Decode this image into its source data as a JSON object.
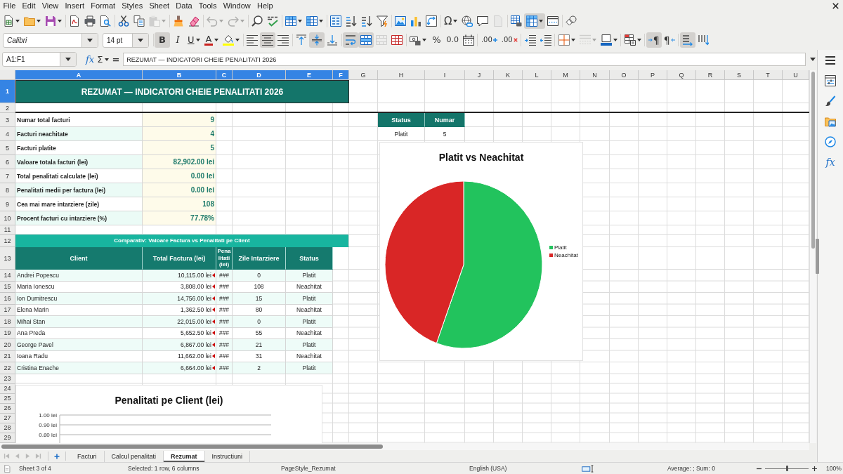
{
  "menu_bar": [
    "File",
    "Edit",
    "View",
    "Insert",
    "Format",
    "Styles",
    "Sheet",
    "Data",
    "Tools",
    "Window",
    "Help"
  ],
  "standard_toolbar": [
    [
      {
        "kind": "new",
        "pressed": false,
        "disabled": false
      },
      {
        "kind": "open",
        "pressed": false,
        "disabled": false
      },
      {
        "kind": "save",
        "pressed": false,
        "disabled": false
      }
    ],
    [
      {
        "kind": "pdf",
        "pressed": false,
        "disabled": false
      },
      {
        "kind": "print",
        "pressed": false,
        "disabled": false
      },
      {
        "kind": "preview",
        "pressed": false,
        "disabled": false
      }
    ],
    [
      {
        "kind": "cut",
        "pressed": false,
        "disabled": false
      },
      {
        "kind": "copy",
        "pressed": false,
        "disabled": false
      },
      {
        "kind": "paste",
        "pressed": false,
        "disabled": true
      }
    ],
    [
      {
        "kind": "clone",
        "pressed": false,
        "disabled": false
      },
      {
        "kind": "clear",
        "pressed": false,
        "disabled": false
      }
    ],
    [
      {
        "kind": "undo",
        "pressed": false,
        "disabled": true
      },
      {
        "kind": "redo",
        "pressed": false,
        "disabled": true
      }
    ],
    [
      {
        "kind": "find",
        "pressed": false,
        "disabled": false
      },
      {
        "kind": "spelling",
        "pressed": false,
        "disabled": false
      }
    ],
    [
      {
        "kind": "rows",
        "pressed": false,
        "disabled": false
      },
      {
        "kind": "columns",
        "pressed": false,
        "disabled": false
      }
    ],
    [
      {
        "kind": "sort",
        "pressed": false,
        "disabled": false
      },
      {
        "kind": "ascending",
        "pressed": false,
        "disabled": false
      },
      {
        "kind": "descending",
        "pressed": false,
        "disabled": false
      },
      {
        "kind": "autofilter",
        "pressed": false,
        "disabled": false
      }
    ],
    [
      {
        "kind": "image",
        "pressed": false,
        "disabled": false
      },
      {
        "kind": "chart",
        "pressed": false,
        "disabled": false
      },
      {
        "kind": "pivot",
        "pressed": false,
        "disabled": false
      }
    ],
    [
      {
        "kind": "symbol",
        "label": "Ω",
        "pressed": false,
        "disabled": false
      },
      {
        "kind": "hyperlink",
        "pressed": false,
        "disabled": false
      },
      {
        "kind": "comment",
        "pressed": false,
        "disabled": false
      },
      {
        "kind": "headers",
        "pressed": false,
        "disabled": true
      }
    ],
    [
      {
        "kind": "printarea",
        "pressed": false,
        "disabled": false
      },
      {
        "kind": "freeze",
        "pressed": true,
        "disabled": false
      },
      {
        "kind": "split",
        "pressed": false,
        "disabled": false
      }
    ],
    [
      {
        "kind": "shapes",
        "pressed": false,
        "disabled": false
      }
    ]
  ],
  "formatting_toolbar": {
    "font_name": "Calibri",
    "font_size": "14 pt",
    "groups": [
      [
        {
          "kind": "bold",
          "label": "B",
          "pressed": true,
          "disabled": false
        },
        {
          "kind": "italic",
          "label": "I",
          "pressed": false,
          "disabled": false
        },
        {
          "kind": "underline",
          "label": "U",
          "pressed": false,
          "disabled": false
        },
        {
          "kind": "fontcolor",
          "label": "A",
          "pressed": false,
          "disabled": false
        },
        {
          "kind": "highlight",
          "pressed": false,
          "disabled": false
        }
      ],
      [
        {
          "kind": "left",
          "pressed": false,
          "disabled": false
        },
        {
          "kind": "center",
          "pressed": true,
          "disabled": false
        },
        {
          "kind": "right",
          "pressed": false,
          "disabled": false
        }
      ],
      [
        {
          "kind": "top",
          "pressed": false,
          "disabled": false
        },
        {
          "kind": "middle",
          "pressed": true,
          "disabled": false
        },
        {
          "kind": "bottom",
          "pressed": false,
          "disabled": false
        }
      ],
      [
        {
          "kind": "wrap",
          "pressed": true,
          "disabled": false
        },
        {
          "kind": "mergecenter",
          "pressed": true,
          "disabled": false
        },
        {
          "kind": "merge",
          "pressed": false,
          "disabled": true
        },
        {
          "kind": "unmerge",
          "pressed": false,
          "disabled": false
        }
      ],
      [
        {
          "kind": "currency",
          "pressed": false,
          "disabled": false
        },
        {
          "kind": "percent",
          "label": "%",
          "pressed": false,
          "disabled": false
        },
        {
          "kind": "number",
          "label": "0.0",
          "pressed": false,
          "disabled": false
        },
        {
          "kind": "date",
          "pressed": false,
          "disabled": false
        }
      ],
      [
        {
          "kind": "adddecimal",
          "label": ".00",
          "pressed": false,
          "disabled": false
        },
        {
          "kind": "deldecimal",
          "label": ".00",
          "pressed": false,
          "disabled": false
        }
      ],
      [
        {
          "kind": "indent",
          "pressed": false,
          "disabled": false
        },
        {
          "kind": "outdent",
          "pressed": false,
          "disabled": false
        }
      ],
      [
        {
          "kind": "borders",
          "pressed": false,
          "disabled": false
        },
        {
          "kind": "borderstyle",
          "pressed": false,
          "disabled": true
        },
        {
          "kind": "bordercolor",
          "pressed": false,
          "disabled": false
        }
      ],
      [
        {
          "kind": "conditional",
          "pressed": false,
          "disabled": false
        }
      ],
      [
        {
          "kind": "ltr",
          "label": "¶",
          "pressed": true,
          "disabled": false
        },
        {
          "kind": "rtl",
          "label": "¶",
          "pressed": false,
          "disabled": false
        }
      ],
      [
        {
          "kind": "horizontal",
          "pressed": true,
          "disabled": false
        },
        {
          "kind": "vertical",
          "pressed": false,
          "disabled": false
        }
      ]
    ]
  },
  "formula_bar": {
    "name_box": "A1:F1",
    "wizard": "fx",
    "sum": "Σ",
    "equals": "=",
    "value": "REZUMAT — INDICATORI CHEIE PENALITATI 2026"
  },
  "sheet": {
    "column_headers": [
      {
        "label": "A",
        "selected": true
      },
      {
        "label": "B",
        "selected": true
      },
      {
        "label": "C",
        "selected": true
      },
      {
        "label": "D",
        "selected": true
      },
      {
        "label": "E",
        "selected": true
      },
      {
        "label": "F",
        "selected": true
      },
      {
        "label": "G",
        "selected": false
      },
      {
        "label": "H",
        "selected": false
      },
      {
        "label": "I",
        "selected": false
      },
      {
        "label": "J",
        "selected": false
      },
      {
        "label": "K",
        "selected": false
      },
      {
        "label": "L",
        "selected": false
      },
      {
        "label": "M",
        "selected": false
      },
      {
        "label": "N",
        "selected": false
      },
      {
        "label": "O",
        "selected": false
      },
      {
        "label": "P",
        "selected": false
      },
      {
        "label": "Q",
        "selected": false
      },
      {
        "label": "R",
        "selected": false
      },
      {
        "label": "S",
        "selected": false
      },
      {
        "label": "T",
        "selected": false
      },
      {
        "label": "U",
        "selected": false
      }
    ],
    "row_headers": [
      {
        "label": "1",
        "selected": true
      },
      {
        "label": "2",
        "selected": false
      },
      {
        "label": "3",
        "selected": false
      },
      {
        "label": "4",
        "selected": false
      },
      {
        "label": "5",
        "selected": false
      },
      {
        "label": "6",
        "selected": false
      },
      {
        "label": "7",
        "selected": false
      },
      {
        "label": "8",
        "selected": false
      },
      {
        "label": "9",
        "selected": false
      },
      {
        "label": "10",
        "selected": false
      },
      {
        "label": "11",
        "selected": false
      },
      {
        "label": "12",
        "selected": false
      },
      {
        "label": "13",
        "selected": false
      },
      {
        "label": "14",
        "selected": false
      },
      {
        "label": "15",
        "selected": false
      },
      {
        "label": "16",
        "selected": false
      },
      {
        "label": "17",
        "selected": false
      },
      {
        "label": "18",
        "selected": false
      },
      {
        "label": "19",
        "selected": false
      },
      {
        "label": "20",
        "selected": false
      },
      {
        "label": "21",
        "selected": false
      },
      {
        "label": "22",
        "selected": false
      },
      {
        "label": "23",
        "selected": false
      },
      {
        "label": "24",
        "selected": false
      },
      {
        "label": "25",
        "selected": false
      },
      {
        "label": "26",
        "selected": false
      },
      {
        "label": "27",
        "selected": false
      },
      {
        "label": "28",
        "selected": false
      },
      {
        "label": "29",
        "selected": false
      }
    ],
    "title": {
      "text": "REZUMAT — INDICATORI CHEIE PENALITATI 2026",
      "selected": true
    },
    "indicators": [
      {
        "label": "Numar total facturi",
        "value": "9"
      },
      {
        "label": "Facturi neachitate",
        "value": "4"
      },
      {
        "label": "Facturi platite",
        "value": "5"
      },
      {
        "label": "Valoare totala facturi (lei)",
        "value": "82,902.00 lei"
      },
      {
        "label": "Total penalitati calculate (lei)",
        "value": "0.00 lei"
      },
      {
        "label": "Penalitati medii per factura (lei)",
        "value": "0.00 lei"
      },
      {
        "label": "Cea mai mare intarziere (zile)",
        "value": "108"
      },
      {
        "label": "Procent facturi cu intarziere (%)",
        "value": "77.78%"
      }
    ],
    "status_summary": {
      "columns": [
        "Status",
        "Numar"
      ],
      "rows": [
        [
          "Platit",
          "5"
        ]
      ]
    },
    "comparison_title": "Comparativ: Valoare Factura vs Penalitati pe Client",
    "client_table": {
      "columns": [
        "Client",
        "Total Factura (lei)",
        "Penalitati (lei)",
        "Zile Intarziere",
        "Status"
      ],
      "rows": [
        {
          "client": "Andrei Popescu",
          "total": "10,115.00 lei",
          "overflow": true,
          "penalty": "###",
          "days": "0",
          "status": "Platit"
        },
        {
          "client": "Maria Ionescu",
          "total": "3,808.00 lei",
          "overflow": true,
          "penalty": "###",
          "days": "108",
          "status": "Neachitat"
        },
        {
          "client": "Ion Dumitrescu",
          "total": "14,756.00 lei",
          "overflow": true,
          "penalty": "###",
          "days": "15",
          "status": "Platit"
        },
        {
          "client": "Elena Marin",
          "total": "1,362.50 lei",
          "overflow": true,
          "penalty": "###",
          "days": "80",
          "status": "Neachitat"
        },
        {
          "client": "Mihai Stan",
          "total": "22,015.00 lei",
          "overflow": true,
          "penalty": "###",
          "days": "0",
          "status": "Platit"
        },
        {
          "client": "Ana Preda",
          "total": "5,652.50 lei",
          "overflow": true,
          "penalty": "###",
          "days": "55",
          "status": "Neachitat"
        },
        {
          "client": "George Pavel",
          "total": "6,867.00 lei",
          "overflow": true,
          "penalty": "###",
          "days": "21",
          "status": "Platit"
        },
        {
          "client": "Ioana Radu",
          "total": "11,662.00 lei",
          "overflow": true,
          "penalty": "###",
          "days": "31",
          "status": "Neachitat"
        },
        {
          "client": "Cristina Enache",
          "total": "6,664.00 lei",
          "overflow": true,
          "penalty": "###",
          "days": "2",
          "status": "Platit"
        }
      ]
    },
    "pie_chart": {
      "chart_data": {
        "type": "pie",
        "title": "Platit vs Neachitat",
        "categories": [
          "Platit",
          "Neachitat"
        ],
        "values": [
          55.6,
          44.4
        ],
        "legend": "right"
      },
      "slices": [
        {
          "color": "#22c35d"
        },
        {
          "color": "#d92626"
        }
      ]
    },
    "bar_chart": {
      "title": "Penalitati pe Client (lei)",
      "axis_labels": [
        "1.00 lei",
        "0.90 lei",
        "0.80 lei"
      ]
    }
  },
  "sidebar": [
    {
      "kind": "menu"
    },
    {
      "kind": "properties"
    },
    {
      "kind": "styles"
    },
    {
      "kind": "gallery"
    },
    {
      "kind": "navigator"
    },
    {
      "kind": "functions",
      "label": "fx"
    }
  ],
  "sheet_nav": [
    {
      "kind": "first",
      "disabled": true
    },
    {
      "kind": "previous",
      "disabled": true
    },
    {
      "kind": "next",
      "disabled": true
    },
    {
      "kind": "last",
      "disabled": true
    }
  ],
  "sheet_tabs": [
    {
      "label": "Facturi",
      "selected": false
    },
    {
      "label": "Calcul penalitati",
      "selected": false
    },
    {
      "label": "Rezumat",
      "selected": true
    },
    {
      "label": "Instructiuni",
      "selected": false
    }
  ],
  "status_bar": {
    "sheet": "Sheet 3 of 4",
    "selection": "Selected: 1 row, 6 columns",
    "page_style": "PageStyle_Rezumat",
    "language": "English (USA)",
    "summary": "Average: ; Sum: 0",
    "zoom": {
      "level": 0.5,
      "value": "100%"
    }
  }
}
